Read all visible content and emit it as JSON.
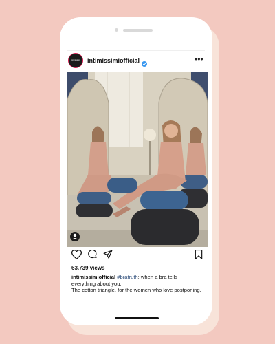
{
  "post": {
    "username": "intimissimiofficial",
    "avatar_text": "intimissimi",
    "views": "63.739 views",
    "caption": {
      "username": "intimissimiofficial",
      "hashtag": "#bratruth",
      "text1": ": when a bra tells everything about you.",
      "text2": "The cotton triangle, for the women who love postponing."
    }
  },
  "icons": {
    "verified": "verified-badge-icon",
    "more": "more-options-icon",
    "like": "heart-icon",
    "comment": "comment-icon",
    "share": "send-icon",
    "save": "bookmark-icon",
    "tagged": "tagged-user-icon"
  },
  "colors": {
    "background": "#f3c9c0",
    "verified": "#3897f0",
    "hashtag": "#2d4d7a"
  }
}
